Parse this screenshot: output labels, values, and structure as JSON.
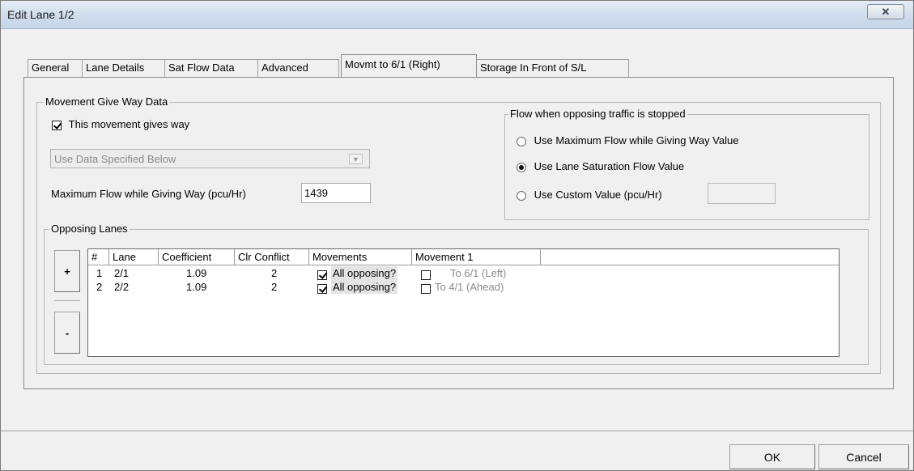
{
  "window": {
    "title": "Edit Lane 1/2",
    "close_glyph": "✕"
  },
  "tabs": [
    {
      "label": "General"
    },
    {
      "label": "Lane Details"
    },
    {
      "label": "Sat Flow Data"
    },
    {
      "label": "Advanced"
    },
    {
      "label": "Movmt to 6/1 (Right)"
    },
    {
      "label": "Storage In Front of S/L"
    }
  ],
  "give_way": {
    "legend": "Movement Give Way Data",
    "gives_way_label": "This movement gives way",
    "gives_way_checked": true,
    "data_source_value": "Use Data Specified Below",
    "max_flow_label": "Maximum Flow while Giving Way (pcu/Hr)",
    "max_flow_value": "1439"
  },
  "flow_stopped": {
    "legend": "Flow when opposing traffic is stopped",
    "options": [
      {
        "label": "Use Maximum Flow while Giving Way Value",
        "selected": false
      },
      {
        "label": "Use Lane Saturation Flow Value",
        "selected": true
      },
      {
        "label": "Use Custom Value (pcu/Hr)",
        "selected": false
      }
    ],
    "custom_value": ""
  },
  "opposing_lanes": {
    "legend": "Opposing Lanes",
    "add_label": "+",
    "remove_label": "-",
    "columns": [
      "#",
      "Lane",
      "Coefficient",
      "Clr Conflict",
      "Movements",
      "Movement 1"
    ],
    "rows": [
      {
        "num": "1",
        "lane": "2/1",
        "coefficient": "1.09",
        "clr_conflict": "2",
        "all_opposing_checked": true,
        "all_opposing_label": "All opposing?",
        "movement1_checked": false,
        "movement1_label": "To 6/1 (Left)"
      },
      {
        "num": "2",
        "lane": "2/2",
        "coefficient": "1.09",
        "clr_conflict": "2",
        "all_opposing_checked": true,
        "all_opposing_label": "All opposing?",
        "movement1_checked": false,
        "movement1_label": "To 4/1 (Ahead)"
      }
    ]
  },
  "buttons": {
    "ok": "OK",
    "cancel": "Cancel"
  }
}
